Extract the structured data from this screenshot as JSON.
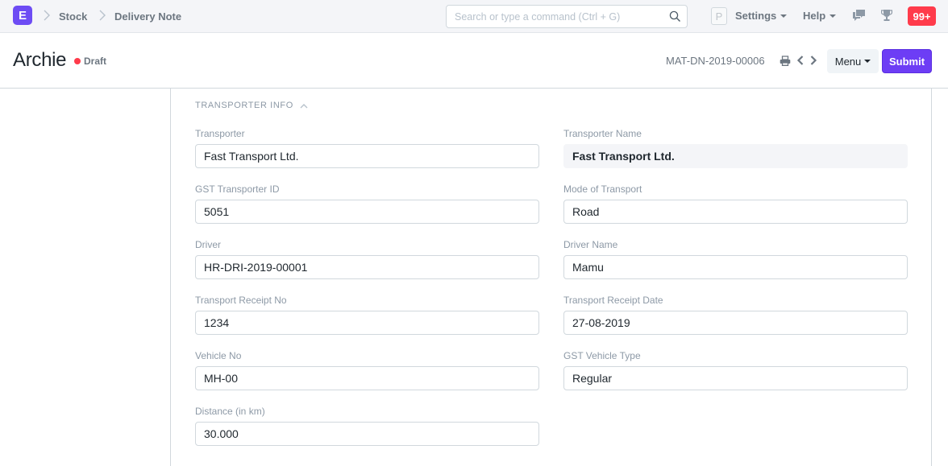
{
  "navbar": {
    "logo_letter": "E",
    "breadcrumbs": [
      "Stock",
      "Delivery Note"
    ],
    "search_placeholder": "Search or type a command (Ctrl + G)",
    "user_initial": "P",
    "settings_label": "Settings",
    "help_label": "Help",
    "notifications_count": "99+",
    "colors": {
      "brand": "#6d4cf4",
      "badge": "#ff3b4b"
    }
  },
  "page_head": {
    "title": "Archie",
    "status": "Draft",
    "status_color": "#ff3b4b",
    "doc_name": "MAT-DN-2019-00006",
    "menu_label": "Menu",
    "submit_label": "Submit",
    "submit_color": "#6d3df5"
  },
  "section": {
    "title": "TRANSPORTER INFO",
    "collapsed": false,
    "fields_left": [
      {
        "label": "Transporter",
        "value": "Fast Transport Ltd."
      },
      {
        "label": "GST Transporter ID",
        "value": "5051"
      },
      {
        "label": "Driver",
        "value": "HR-DRI-2019-00001"
      },
      {
        "label": "Transport Receipt No",
        "value": "1234"
      },
      {
        "label": "Vehicle No",
        "value": "MH-00"
      },
      {
        "label": "Distance (in km)",
        "value": "30.000"
      }
    ],
    "fields_right": [
      {
        "label": "Transporter Name",
        "value": "Fast Transport Ltd.",
        "read_only": true
      },
      {
        "label": "Mode of Transport",
        "value": "Road"
      },
      {
        "label": "Driver Name",
        "value": "Mamu"
      },
      {
        "label": "Transport Receipt Date",
        "value": "27-08-2019"
      },
      {
        "label": "GST Vehicle Type",
        "value": "Regular"
      }
    ]
  }
}
